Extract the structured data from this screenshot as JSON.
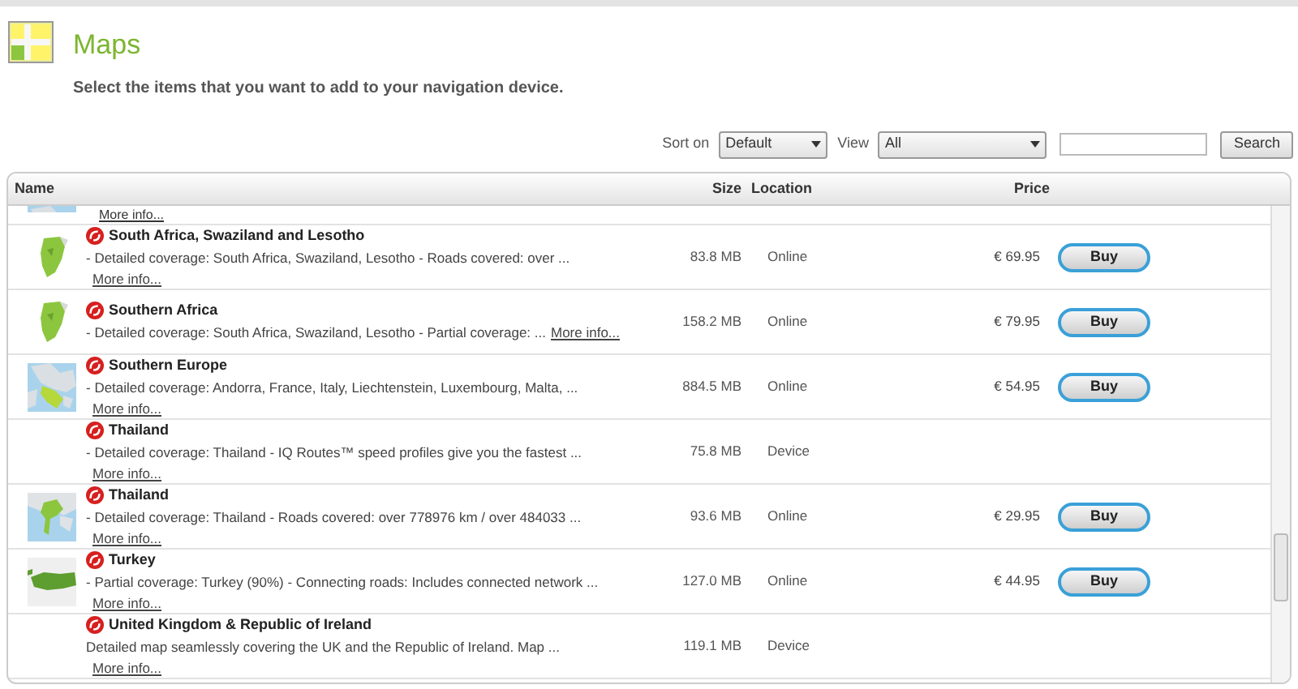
{
  "header": {
    "title": "Maps",
    "subtitle": "Select the items that you want to add to your navigation device."
  },
  "toolbar": {
    "sort_label": "Sort on",
    "sort_value": "Default",
    "view_label": "View",
    "view_value": "All",
    "search_button": "Search"
  },
  "table": {
    "columns": [
      "Name",
      "Size",
      "Location",
      "Price"
    ],
    "partial_row": {
      "more_info": "More info..."
    },
    "rows": [
      {
        "name": "South Africa, Swaziland and Lesotho",
        "description": "- Detailed coverage: South Africa, Swaziland, Lesotho - Roads covered: over ...",
        "more_info": "More info...",
        "size": "83.8 MB",
        "location": "Online",
        "price": "€ 69.95",
        "buy": "Buy"
      },
      {
        "name": "Southern Africa",
        "description": "- Detailed coverage: South Africa, Swaziland, Lesotho - Partial coverage: ...",
        "inline_more_info": "More info...",
        "size": "158.2 MB",
        "location": "Online",
        "price": "€ 79.95",
        "buy": "Buy"
      },
      {
        "name": "Southern Europe",
        "description": "- Detailed coverage: Andorra, France, Italy, Liechtenstein, Luxembourg, Malta, ...",
        "more_info": "More info...",
        "size": "884.5 MB",
        "location": "Online",
        "price": "€ 54.95",
        "buy": "Buy"
      },
      {
        "name": "Thailand",
        "description": "- Detailed coverage: Thailand - IQ Routes™ speed profiles give you the fastest ...",
        "more_info": "More info...",
        "size": "75.8 MB",
        "location": "Device"
      },
      {
        "name": "Thailand",
        "description": "- Detailed coverage: Thailand - Roads covered: over 778976 km / over 484033 ...",
        "more_info": "More info...",
        "size": "93.6 MB",
        "location": "Online",
        "price": "€ 29.95",
        "buy": "Buy"
      },
      {
        "name": "Turkey",
        "description": "- Partial coverage: Turkey (90%) - Connecting roads: Includes connected network ...",
        "more_info": "More info...",
        "size": "127.0 MB",
        "location": "Online",
        "price": "€ 44.95",
        "buy": "Buy"
      },
      {
        "name": "United Kingdom & Republic of Ireland",
        "description": "Detailed map seamlessly covering the UK and the Republic of Ireland. Map ...",
        "more_info": "More info...",
        "size": "119.1 MB",
        "location": "Device"
      }
    ]
  }
}
